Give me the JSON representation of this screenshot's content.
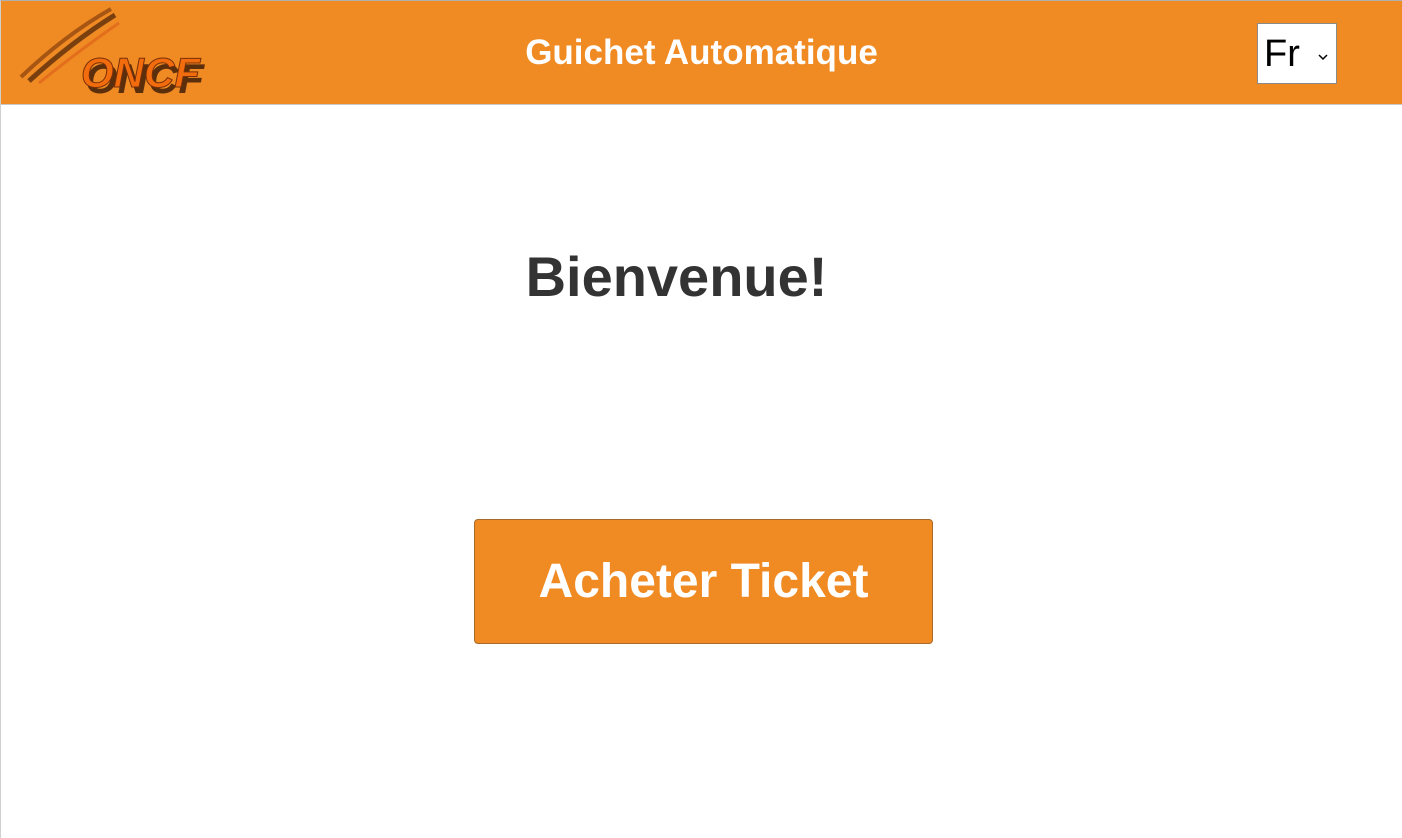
{
  "colors": {
    "brand_orange": "#f08a23",
    "heading_text": "#333333",
    "white": "#ffffff"
  },
  "header": {
    "logo_text": "ONCF",
    "title": "Guichet Automatique",
    "language": {
      "selected": "Fr",
      "icon": "chevron-down-icon"
    }
  },
  "main": {
    "welcome": "Bienvenue!",
    "buy_button_label": "Acheter Ticket"
  }
}
